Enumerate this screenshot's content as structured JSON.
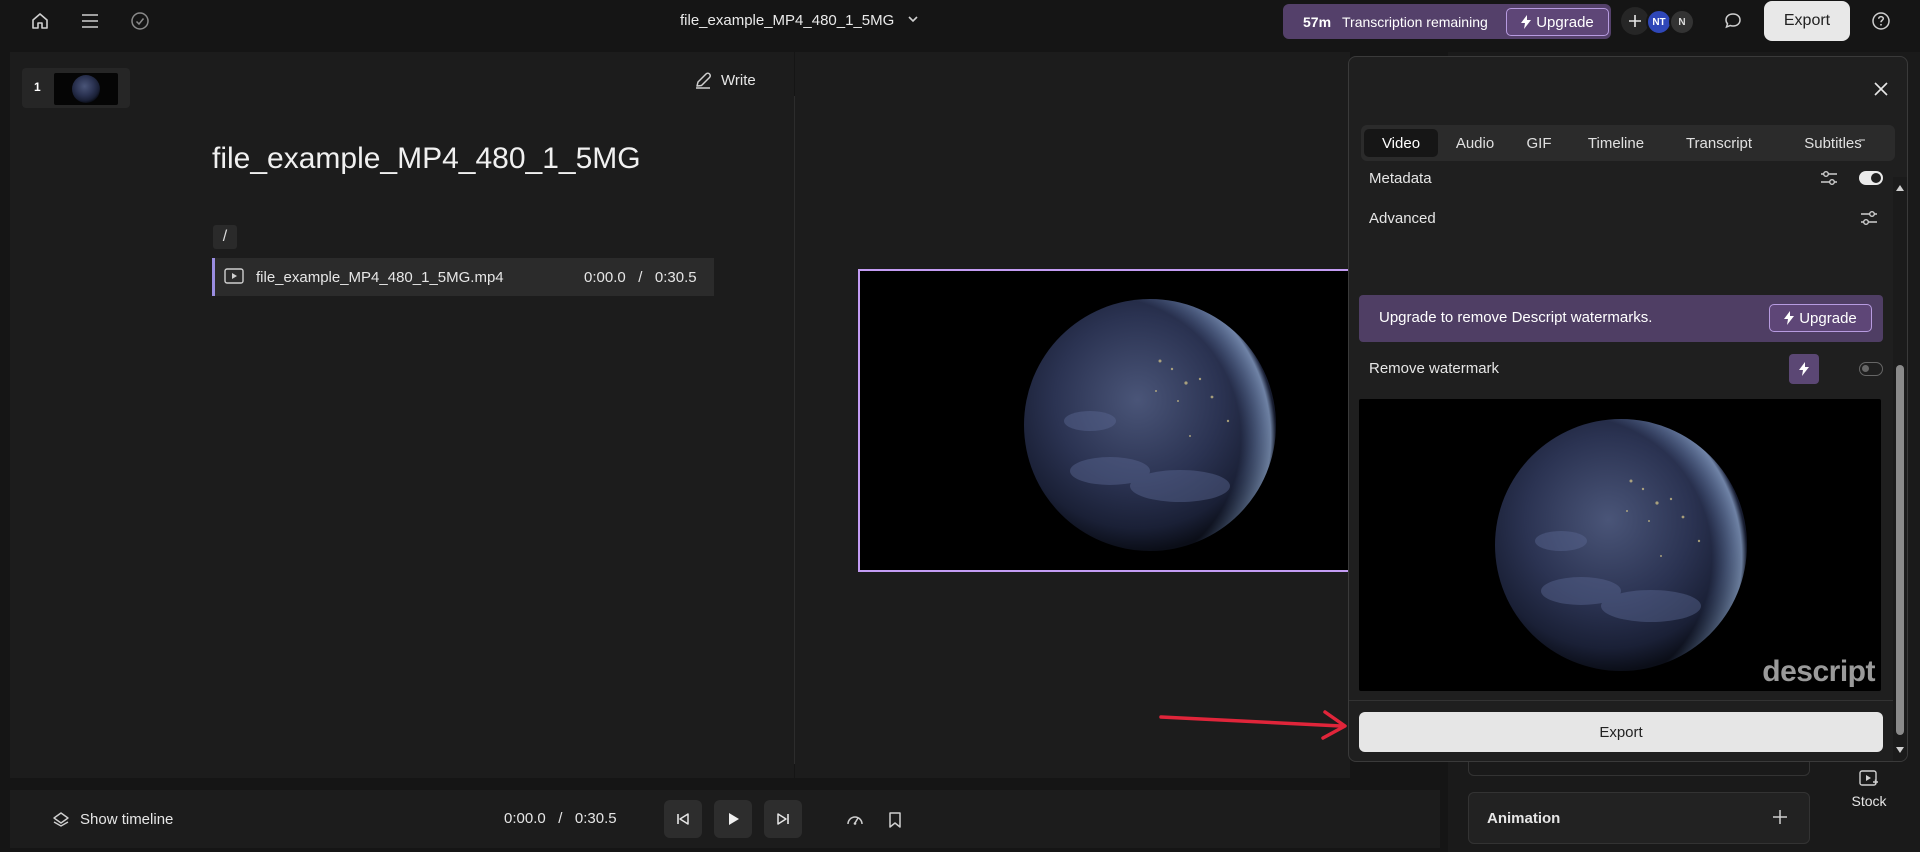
{
  "topbar": {
    "doc_title": "file_example_MP4_480_1_5MG",
    "transcription_minutes": "57m",
    "transcription_text": "Transcription remaining",
    "upgrade_label": "Upgrade",
    "avatar_nt": "NT",
    "avatar_n": "N",
    "export_label": "Export"
  },
  "script": {
    "scene_number": "1",
    "write_label": "Write",
    "title": "file_example_MP4_480_1_5MG",
    "slash": "/",
    "clip_name": "file_example_MP4_480_1_5MG.mp4",
    "clip_time": "0:00.0   /   0:30.5"
  },
  "bottombar": {
    "show_timeline": "Show timeline",
    "time": "0:00.0   /   0:30.5"
  },
  "sidebar": {
    "animation_label": "Animation",
    "stock_label": "Stock"
  },
  "export_panel": {
    "tabs": [
      "Video",
      "Audio",
      "GIF",
      "Timeline",
      "Transcript",
      "Subtitles"
    ],
    "active_tab": "Video",
    "metadata_label": "Metadata",
    "metadata_enabled": true,
    "advanced_label": "Advanced",
    "upsell_text": "Upgrade to remove Descript watermarks.",
    "upsell_button": "Upgrade",
    "remove_watermark_label": "Remove watermark",
    "remove_watermark_enabled": false,
    "watermark_text": "descript",
    "export_button": "Export"
  },
  "colors": {
    "accent_purple": "#c39cf3",
    "upsell_bg": "#4f3e64",
    "annotation_arrow": "#e0253a"
  },
  "icons": [
    "home-icon",
    "menu-icon",
    "check-circle-icon",
    "chevron-down-icon",
    "bolt-icon",
    "plus-icon",
    "comment-icon",
    "help-icon",
    "pen-icon",
    "layout-icon",
    "play-box-icon",
    "layers-icon",
    "skip-back-icon",
    "play-icon",
    "skip-forward-icon",
    "speed-icon",
    "bookmark-icon",
    "close-icon",
    "sliders-icon",
    "stock-icon"
  ]
}
